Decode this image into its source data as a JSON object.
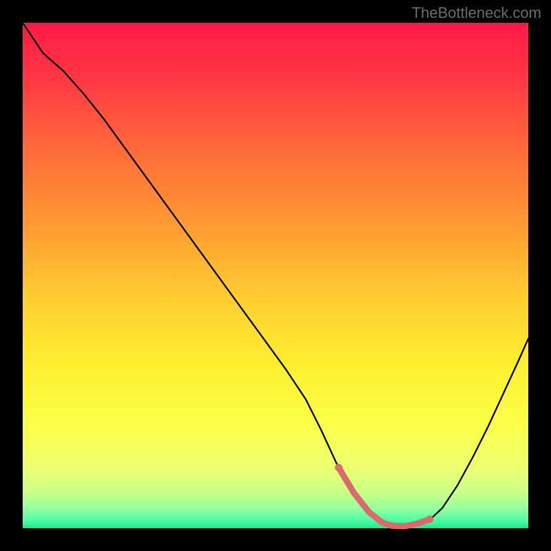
{
  "watermark": "TheBottleneck.com",
  "colors": {
    "background": "#000000",
    "curve": "#000000",
    "highlight": "#d86b6b",
    "watermark": "#6e6e6e",
    "gradient_stops": [
      {
        "offset": 0.0,
        "color": "#ff1a47"
      },
      {
        "offset": 0.1,
        "color": "#ff3445"
      },
      {
        "offset": 0.25,
        "color": "#ff6a3a"
      },
      {
        "offset": 0.4,
        "color": "#ff9a33"
      },
      {
        "offset": 0.55,
        "color": "#ffcf30"
      },
      {
        "offset": 0.68,
        "color": "#fff030"
      },
      {
        "offset": 0.8,
        "color": "#fbff4a"
      },
      {
        "offset": 0.88,
        "color": "#edff70"
      },
      {
        "offset": 0.93,
        "color": "#c9ff8a"
      },
      {
        "offset": 0.96,
        "color": "#97ffa0"
      },
      {
        "offset": 0.985,
        "color": "#4dffa6"
      },
      {
        "offset": 1.0,
        "color": "#18e888"
      }
    ]
  },
  "chart_data": {
    "type": "line",
    "title": "",
    "xlabel": "",
    "ylabel": "",
    "xlim": [
      0,
      100
    ],
    "ylim": [
      0,
      100
    ],
    "series": [
      {
        "name": "bottleneck-curve",
        "x": [
          0,
          4,
          8,
          12,
          16,
          20,
          24,
          28,
          32,
          36,
          40,
          44,
          48,
          52,
          56,
          59,
          62,
          65,
          68,
          71,
          74,
          77,
          80,
          83,
          86,
          89,
          92,
          95,
          98,
          100
        ],
        "y": [
          100,
          94,
          90.5,
          86,
          81,
          75.5,
          70,
          64.5,
          59,
          53.5,
          48,
          42.5,
          37,
          31.5,
          25.5,
          19.5,
          13,
          7.5,
          3.5,
          1.2,
          0.4,
          0.4,
          1.2,
          4.0,
          8.5,
          14,
          20,
          26.5,
          33,
          37.5
        ]
      }
    ],
    "highlight": {
      "name": "optimal-range",
      "x": [
        62.5,
        65.5,
        68.5,
        71,
        73,
        75.5,
        78,
        80.5
      ],
      "y": [
        12.0,
        7.0,
        3.2,
        1.2,
        0.5,
        0.4,
        0.9,
        1.8
      ]
    }
  }
}
